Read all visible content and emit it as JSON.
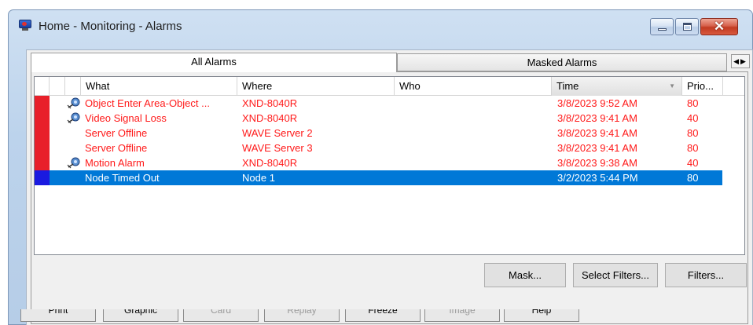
{
  "window": {
    "title": "Home - Monitoring - Alarms",
    "close_glyph": "✕"
  },
  "tabs": [
    {
      "label": "All Alarms",
      "active": true
    },
    {
      "label": "Masked Alarms",
      "active": false
    }
  ],
  "tab_scroll": "◀▶",
  "columns": {
    "what": "What",
    "where": "Where",
    "who": "Who",
    "time": "Time",
    "priority": "Prio..."
  },
  "sort_indicator": "▼",
  "rows": [
    {
      "color": "#e8202a",
      "has_attachment": true,
      "what": "Object Enter Area-Object ...",
      "where": "XND-8040R",
      "who": "",
      "time": "3/8/2023 9:52 AM",
      "priority": "80"
    },
    {
      "color": "#e8202a",
      "has_attachment": true,
      "what": "Video Signal Loss",
      "where": "XND-8040R",
      "who": "",
      "time": "3/8/2023 9:41 AM",
      "priority": "40"
    },
    {
      "color": "#e8202a",
      "has_attachment": false,
      "what": "Server Offline",
      "where": "WAVE Server 2",
      "who": "",
      "time": "3/8/2023 9:41 AM",
      "priority": "80"
    },
    {
      "color": "#e8202a",
      "has_attachment": false,
      "what": "Server Offline",
      "where": "WAVE Server 3",
      "who": "",
      "time": "3/8/2023 9:41 AM",
      "priority": "80"
    },
    {
      "color": "#e8202a",
      "has_attachment": true,
      "what": "Motion Alarm",
      "where": "XND-8040R",
      "who": "",
      "time": "3/8/2023 9:38 AM",
      "priority": "40"
    },
    {
      "color": "#1a1ae0",
      "has_attachment": false,
      "what": "Node Timed Out",
      "where": "Node 1",
      "who": "",
      "time": "3/2/2023 5:44 PM",
      "priority": "80",
      "selected": true
    }
  ],
  "buttons": {
    "mask": "Mask...",
    "select_filters": "Select Filters...",
    "filters": "Filters..."
  },
  "bottom_buttons": [
    {
      "label": "Print",
      "enabled": true
    },
    {
      "label": "Graphic",
      "enabled": true
    },
    {
      "label": "Card",
      "enabled": false
    },
    {
      "label": "Replay",
      "enabled": false
    },
    {
      "label": "Freeze",
      "enabled": true
    },
    {
      "label": "Image",
      "enabled": false
    },
    {
      "label": "Help",
      "enabled": true
    }
  ]
}
